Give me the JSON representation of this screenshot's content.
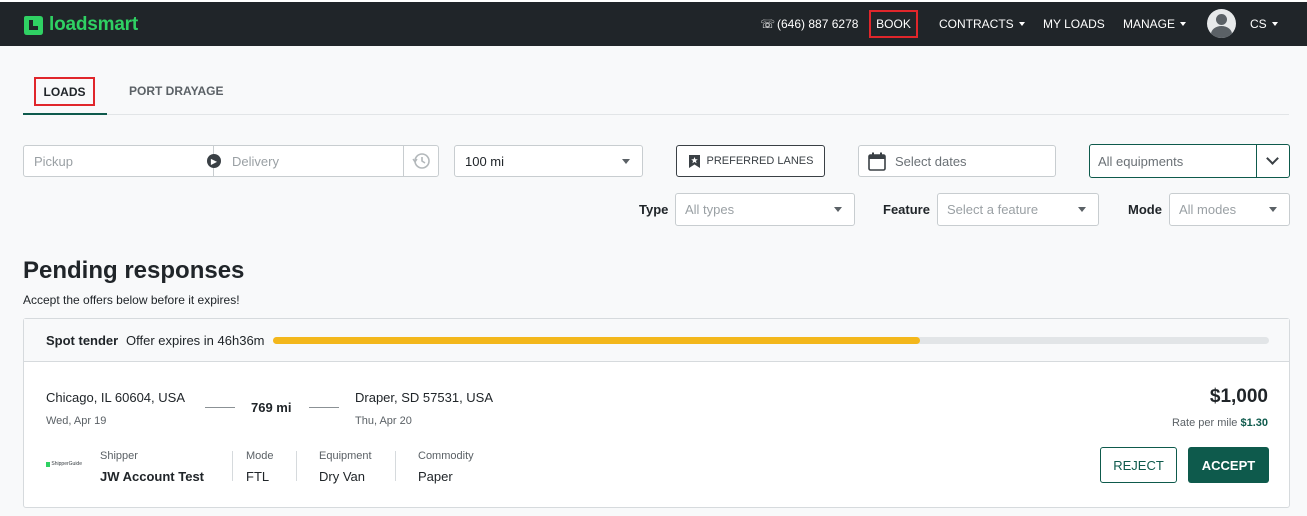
{
  "brand": {
    "name": "loadsmart",
    "color": "#2fd163"
  },
  "nav": {
    "phone": "(646) 887 6278",
    "book": "BOOK",
    "contracts": "CONTRACTS",
    "my_loads": "MY LOADS",
    "manage": "MANAGE",
    "user_initials": "CS"
  },
  "tabs": {
    "loads": "LOADS",
    "port_drayage": "PORT DRAYAGE"
  },
  "search": {
    "pickup_placeholder": "Pickup",
    "delivery_placeholder": "Delivery",
    "radius": "100 mi",
    "preferred_lanes": "PREFERRED LANES",
    "dates_placeholder": "Select dates",
    "equipment": "All equipments"
  },
  "filters": {
    "type_label": "Type",
    "type_value": "All types",
    "feature_label": "Feature",
    "feature_value": "Select a feature",
    "mode_label": "Mode",
    "mode_value": "All modes"
  },
  "pending": {
    "title": "Pending responses",
    "subtitle": "Accept the offers below before it expires!"
  },
  "offer": {
    "kind": "Spot tender",
    "expires": "Offer expires in 46h36m",
    "progress": 0.65,
    "origin": "Chicago, IL 60604, USA",
    "origin_date": "Wed, Apr 19",
    "distance": "769 mi",
    "destination": "Draper, SD 57531, USA",
    "destination_date": "Thu, Apr 20",
    "price": "$1,000",
    "rate_label": "Rate per mile",
    "rate_value": "$1.30",
    "shipper_logo_text": "ShipperGuide",
    "shipper_label": "Shipper",
    "shipper_value": "JW Account Test",
    "mode_label": "Mode",
    "mode_value": "FTL",
    "equipment_label": "Equipment",
    "equipment_value": "Dry Van",
    "commodity_label": "Commodity",
    "commodity_value": "Paper",
    "reject": "REJECT",
    "accept": "ACCEPT"
  },
  "colors": {
    "accent": "#0e5a4c",
    "highlight": "#e0262b",
    "progress": "#f3b71b",
    "nav_bg": "#202529"
  }
}
